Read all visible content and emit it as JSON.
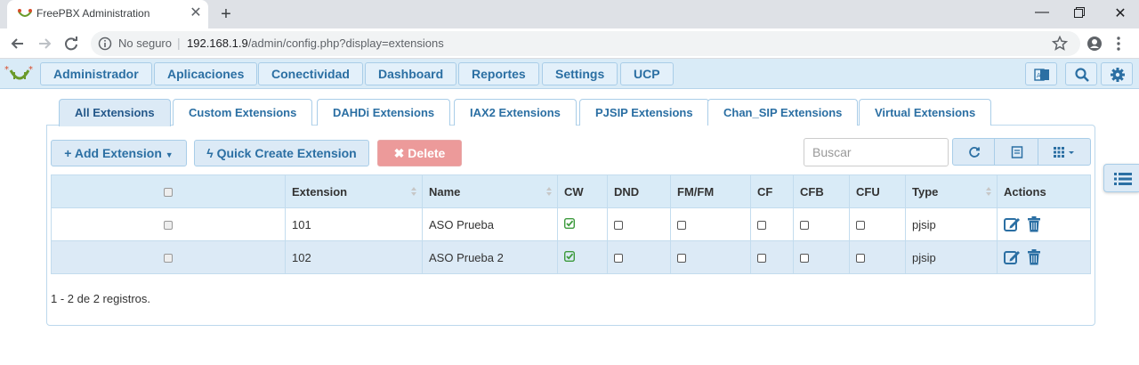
{
  "browser": {
    "tab_title": "FreePBX Administration",
    "insecure_label": "No seguro",
    "url_host": "192.168.1.9",
    "url_path": "/admin/config.php?display=extensions"
  },
  "nav": {
    "items": [
      "Administrador",
      "Aplicaciones",
      "Conectividad",
      "Dashboard",
      "Reportes",
      "Settings",
      "UCP"
    ]
  },
  "tabs": [
    "All Extensions",
    "Custom Extensions",
    "DAHDi Extensions",
    "IAX2 Extensions",
    "PJSIP Extensions",
    "Chan_SIP Extensions",
    "Virtual Extensions"
  ],
  "toolbar": {
    "add_label": "Add Extension",
    "quick_label": "Quick Create Extension",
    "delete_label": "Delete",
    "search_placeholder": "Buscar"
  },
  "table": {
    "columns": [
      "",
      "Extension",
      "Name",
      "CW",
      "DND",
      "FM/FM",
      "CF",
      "CFB",
      "CFU",
      "Type",
      "Actions"
    ],
    "rows": [
      {
        "extension": "101",
        "name": "ASO Prueba",
        "cw": true,
        "dnd": false,
        "fmfm": false,
        "cf": false,
        "cfb": false,
        "cfu": false,
        "type": "pjsip"
      },
      {
        "extension": "102",
        "name": "ASO Prueba 2",
        "cw": true,
        "dnd": false,
        "fmfm": false,
        "cf": false,
        "cfb": false,
        "cfu": false,
        "type": "pjsip"
      }
    ]
  },
  "footer": {
    "records": "1 - 2 de 2 registros."
  },
  "colors": {
    "accent": "#2b6fa3",
    "nav_bg": "#d9ebf7",
    "delete": "#ec9a9a",
    "check_green": "#3c9a3c"
  }
}
